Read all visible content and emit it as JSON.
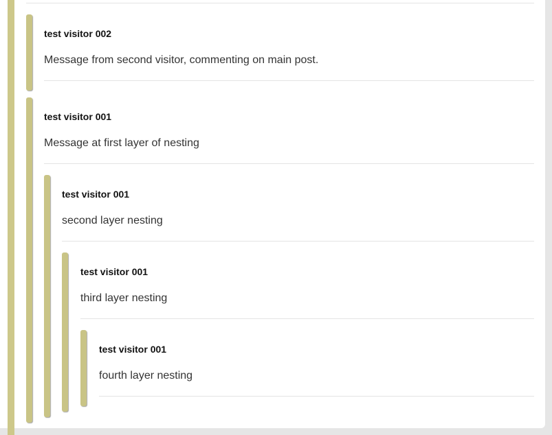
{
  "comments": [
    {
      "author": "test visitor 002",
      "message": "Message from second visitor, commenting on main post."
    },
    {
      "author": "test visitor 001",
      "message": "Message at first layer of nesting"
    },
    {
      "author": "test visitor 001",
      "message": "second layer nesting"
    },
    {
      "author": "test visitor 001",
      "message": "third layer nesting"
    },
    {
      "author": "test visitor 001",
      "message": "fourth layer nesting"
    }
  ],
  "colors": {
    "thread_bar": "#c9c486",
    "background": "#e6e6e6",
    "divider": "#e4e4e4"
  }
}
